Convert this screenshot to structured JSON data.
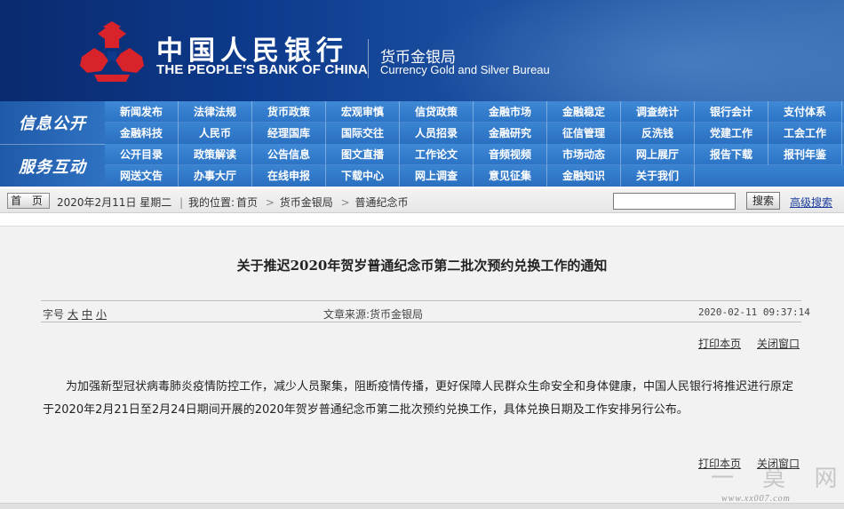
{
  "header": {
    "cn_name": "中国人民银行",
    "en_name": "THE PEOPLE'S BANK OF CHINA",
    "bureau_cn": "货币金银局",
    "bureau_en": "Currency  Gold and Silver Bureau",
    "emblem_icon": "pboc-emblem-icon",
    "colors": {
      "banner": "#0d3a8c",
      "emblem": "#d8232a"
    }
  },
  "nav": {
    "section1_label": "信息公开",
    "section2_label": "服务互动",
    "row1": [
      "新闻发布",
      "法律法规",
      "货币政策",
      "宏观审慎",
      "信贷政策",
      "金融市场",
      "金融稳定",
      "调查统计",
      "银行会计",
      "支付体系"
    ],
    "row2": [
      "金融科技",
      "人民币",
      "经理国库",
      "国际交往",
      "人员招录",
      "金融研究",
      "征信管理",
      "反洗钱",
      "党建工作",
      "工会工作"
    ],
    "row3": [
      "公开目录",
      "政策解读",
      "公告信息",
      "图文直播",
      "工作论文",
      "音频视频",
      "市场动态",
      "网上展厅",
      "报告下载",
      "报刊年鉴"
    ],
    "row4": [
      "网送文告",
      "办事大厅",
      "在线申报",
      "下载中心",
      "网上调查",
      "意见征集",
      "金融知识",
      "关于我们"
    ],
    "colors": {
      "bar": "#2b73c5"
    }
  },
  "crumb": {
    "home_label": "首 页",
    "date_text": "2020年2月11日 星期二",
    "location_label": "我的位置:",
    "path": [
      "首页",
      "货币金银局",
      "普通纪念币"
    ],
    "search_value": "",
    "search_button": "搜索",
    "advanced_search": "高级搜索"
  },
  "article": {
    "title": "关于推迟2020年贺岁普通纪念币第二批次预约兑换工作的通知",
    "font_size_label": "字号",
    "font_sizes": [
      "大",
      "中",
      "小"
    ],
    "source": "文章来源:货币金银局",
    "date": "2020-02-11 09:37:14",
    "print_label": "打印本页",
    "close_label": "关闭窗口",
    "body": "为加强新型冠状病毒肺炎疫情防控工作，减少人员聚集，阻断疫情传播，更好保障人民群众生命安全和身体健康，中国人民银行将推迟进行原定于2020年2月21日至2月24日期间开展的2020年贺岁普通纪念币第二批次预约兑换工作，具体兑换日期及工作安排另行公布。"
  },
  "watermark": {
    "url": "www.xx007.com"
  }
}
